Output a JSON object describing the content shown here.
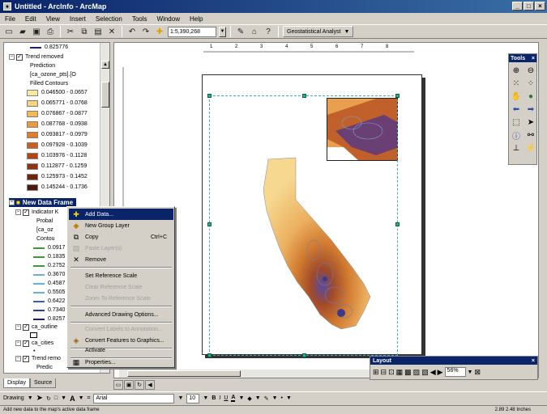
{
  "window": {
    "title": "Untitled - ArcInfo - ArcMap",
    "app_icon": "arcmap-globe-icon"
  },
  "menu": [
    "File",
    "Edit",
    "View",
    "Insert",
    "Selection",
    "Tools",
    "Window",
    "Help"
  ],
  "toolbar": {
    "scale_value": "1:5,390,268",
    "geostat_label": "Geostatistical Analyst"
  },
  "toc": {
    "top_value": "0.825776",
    "trend_removed": "Trend removed",
    "prediction": "Prediction",
    "layer_source": "[ca_ozone_pts].[O",
    "filled_contours": "Filled Contours",
    "classes": [
      {
        "label": "0.046500 - 0.0657",
        "color": "#fbe9a0"
      },
      {
        "label": "0.065771 - 0.0768",
        "color": "#f7d27a"
      },
      {
        "label": "0.076867 - 0.0877",
        "color": "#f3b85a"
      },
      {
        "label": "0.087768 - 0.0938",
        "color": "#ec9a3e"
      },
      {
        "label": "0.093817 - 0.0979",
        "color": "#e07d2b"
      },
      {
        "label": "0.097928 - 0.1039",
        "color": "#cc5f1e"
      },
      {
        "label": "0.103976 - 0.1128",
        "color": "#b14716"
      },
      {
        "label": "0.112877 - 0.1259",
        "color": "#913310"
      },
      {
        "label": "0.125973 - 0.1452",
        "color": "#70230c"
      },
      {
        "label": "0.145244 - 0.1736",
        "color": "#4f1709"
      }
    ],
    "new_data_frame": "New Data Frame",
    "indicator": "Indicator K",
    "sub_prob": "Probal",
    "sub_ca": "[ca_oz",
    "sub_contour": "Contou",
    "contour_lines": [
      {
        "label": "0.0917",
        "color": "#3a9a3a"
      },
      {
        "label": "0.1835",
        "color": "#3a9a3a"
      },
      {
        "label": "0.2752",
        "color": "#3a9a3a"
      },
      {
        "label": "0.3670",
        "color": "#6ab0d8"
      },
      {
        "label": "0.4587",
        "color": "#6ab0d8"
      },
      {
        "label": "0.5505",
        "color": "#6ab0d8"
      },
      {
        "label": "0.6422",
        "color": "#3a5fb0"
      },
      {
        "label": "0.7340",
        "color": "#2a3f90"
      },
      {
        "label": "0.8257",
        "color": "#1a2070"
      }
    ],
    "ca_outline": "ca_outline",
    "ca_cities": "ca_cities",
    "trend_rem2": "Trend remo",
    "predic": "Predic"
  },
  "tabs": {
    "display": "Display",
    "source": "Source"
  },
  "context_menu": {
    "add_data": "Add Data...",
    "new_group": "New Group Layer",
    "copy": "Copy",
    "copy_shortcut": "Ctrl+C",
    "paste": "Paste Layer(s)",
    "remove": "Remove",
    "set_ref": "Set Reference Scale",
    "clear_ref": "Clear Reference Scale",
    "zoom_ref": "Zoom To Reference Scale",
    "adv_draw": "Advanced Drawing Options...",
    "convert_labels": "Convert Labels to Annotation...",
    "convert_features": "Convert Features to Graphics...",
    "activate": "Activate",
    "properties": "Properties..."
  },
  "tools_palette": {
    "title": "Tools"
  },
  "layout_toolbar": {
    "title": "Layout",
    "zoom": "56%"
  },
  "drawing": {
    "drawing_label": "Drawing",
    "font": "Arial",
    "size": "10",
    "bold": "B",
    "italic": "I",
    "underline": "U"
  },
  "status": {
    "message": "Add new data to the map's active data frame",
    "coords": "2.89  2.48 Inches"
  },
  "ruler_marks": [
    "1",
    "2",
    "3",
    "4",
    "5",
    "6",
    "7",
    "8"
  ]
}
